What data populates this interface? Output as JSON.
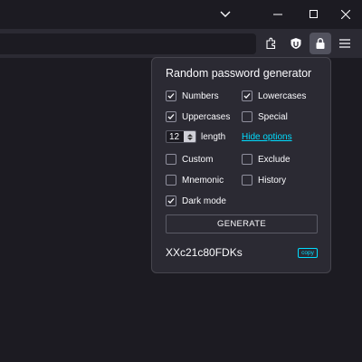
{
  "window_controls": {
    "icons": [
      "chevron-down-icon",
      "minimize-icon",
      "maximize-icon",
      "close-icon"
    ]
  },
  "toolbar": {
    "icons": [
      "extensions-icon",
      "ublock-icon",
      "password-generator-icon",
      "menu-icon"
    ]
  },
  "popup": {
    "title": "Random password generator",
    "options": [
      {
        "label": "Numbers",
        "checked": true
      },
      {
        "label": "Lowercases",
        "checked": true
      },
      {
        "label": "Uppercases",
        "checked": true
      },
      {
        "label": "Special",
        "checked": false
      },
      {
        "label": "Custom",
        "checked": false
      },
      {
        "label": "Exclude",
        "checked": false
      },
      {
        "label": "Mnemonic",
        "checked": false
      },
      {
        "label": "History",
        "checked": false
      },
      {
        "label": "Dark mode",
        "checked": true
      }
    ],
    "length_value": "12",
    "length_label": "length",
    "hide_options_link": "Hide options",
    "generate_label": "GENERATE",
    "password": "XXc21c80FDKs",
    "copy_label": "copy"
  },
  "colors": {
    "background": "#1c1b22",
    "toolbar": "#2b2a33",
    "accent": "#00ddff"
  }
}
